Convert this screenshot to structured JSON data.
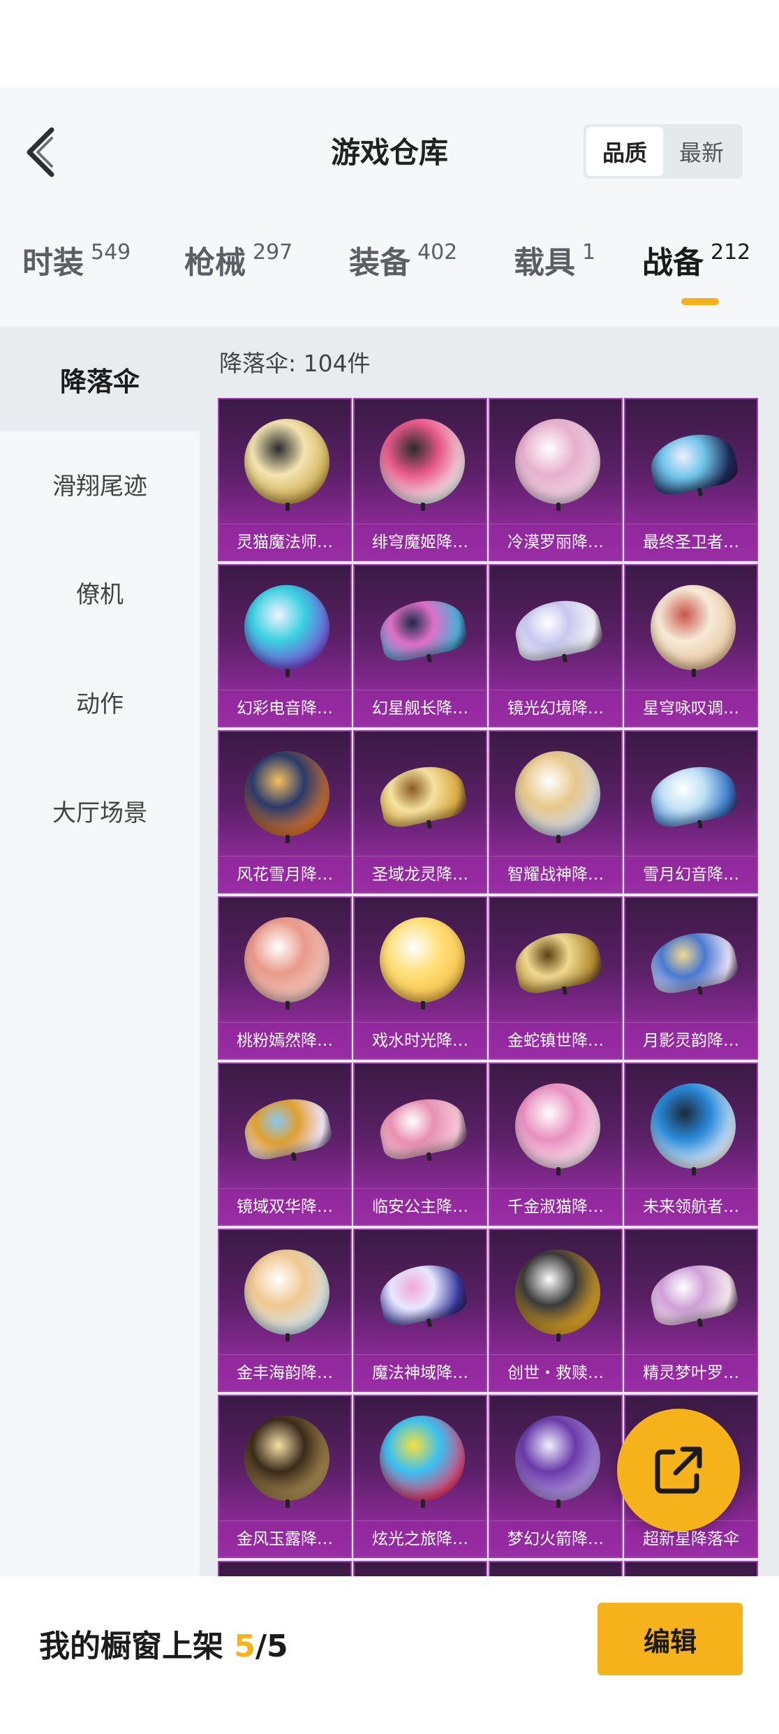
{
  "header": {
    "title": "游戏仓库",
    "sort_options": [
      {
        "label": "品质",
        "active": true
      },
      {
        "label": "最新",
        "active": false
      }
    ]
  },
  "tabs": [
    {
      "label": "时装",
      "count": "549",
      "active": false
    },
    {
      "label": "枪械",
      "count": "297",
      "active": false
    },
    {
      "label": "装备",
      "count": "402",
      "active": false
    },
    {
      "label": "载具",
      "count": "1",
      "active": false
    },
    {
      "label": "战备",
      "count": "212",
      "active": true
    }
  ],
  "sidebar": {
    "items": [
      {
        "label": "降落伞",
        "active": true
      },
      {
        "label": "滑翔尾迹",
        "active": false
      },
      {
        "label": "僚机",
        "active": false
      },
      {
        "label": "动作",
        "active": false
      },
      {
        "label": "大厅场景",
        "active": false
      }
    ]
  },
  "list": {
    "count_label": "降落伞: 104件",
    "items": [
      {
        "name": "灵猫魔法师…"
      },
      {
        "name": "绯穹魔姬降…"
      },
      {
        "name": "冷漠罗丽降…"
      },
      {
        "name": "最终圣卫者…"
      },
      {
        "name": "幻彩电音降…"
      },
      {
        "name": "幻星舰长降…"
      },
      {
        "name": "镜光幻境降…"
      },
      {
        "name": "星穹咏叹调…"
      },
      {
        "name": "风花雪月降…"
      },
      {
        "name": "圣域龙灵降…"
      },
      {
        "name": "智耀战神降…"
      },
      {
        "name": "雪月幻音降…"
      },
      {
        "name": "桃粉嫣然降…"
      },
      {
        "name": "戏水时光降…"
      },
      {
        "name": "金蛇镇世降…"
      },
      {
        "name": "月影灵韵降…"
      },
      {
        "name": "镜域双华降…"
      },
      {
        "name": "临安公主降…"
      },
      {
        "name": "千金淑猫降…"
      },
      {
        "name": "未来领航者…"
      },
      {
        "name": "金丰海韵降…"
      },
      {
        "name": "魔法神域降…"
      },
      {
        "name": "创世・救赎…"
      },
      {
        "name": "精灵梦叶罗…"
      },
      {
        "name": "金风玉露降…"
      },
      {
        "name": "炫光之旅降…"
      },
      {
        "name": "梦幻火箭降…"
      },
      {
        "name": "超新星降落伞"
      },
      {
        "name": ""
      },
      {
        "name": ""
      },
      {
        "name": ""
      },
      {
        "name": ""
      }
    ]
  },
  "footer": {
    "showcase_label": "我的橱窗上架",
    "showcase_current": "5",
    "showcase_sep": "/5",
    "edit_label": "编辑"
  },
  "colors": {
    "accent": "#f6b21a",
    "card_purple": "#8c2a98"
  },
  "icons": {
    "back": "chevron-left-icon",
    "share": "share-external-icon"
  }
}
